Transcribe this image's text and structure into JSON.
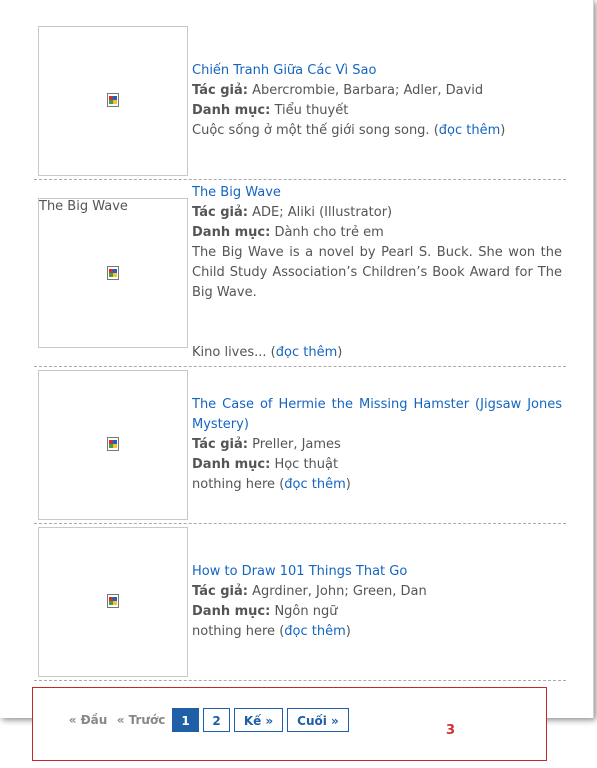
{
  "books": [
    {
      "title": "Chiến Tranh Giữa Các Vì Sao",
      "author_label": "Tác giả:",
      "authors": "Abercrombie, Barbara; Adler, David",
      "category_label": "Danh mục:",
      "category": "Tiểu thuyết",
      "description": "Cuộc sống ở một thế giới song song. (",
      "more": "đọc thêm",
      "close": ")"
    },
    {
      "title": "The Big Wave",
      "image_alt": "The Big Wave",
      "author_label": "Tác giả:",
      "authors": "ADE; Aliki (Illustrator)",
      "category_label": "Danh mục:",
      "category": "Dành cho trẻ em",
      "description": "The Big Wave is a novel by Pearl S. Buck. She won the Child Study Association’s Children’s Book Award for The Big Wave.",
      "tail": "Kino lives... (",
      "more": "đọc thêm",
      "close": ")"
    },
    {
      "title": "The Case of Hermie the Missing Hamster (Jigsaw Jones Mystery)",
      "author_label": "Tác giả:",
      "authors": "Preller, James",
      "category_label": "Danh mục:",
      "category": "Học thuật",
      "description": "nothing here (",
      "more": "đọc thêm",
      "close": ")"
    },
    {
      "title": "How to Draw 101 Things That Go",
      "author_label": "Tác giả:",
      "authors": "Agrdiner, John; Green, Dan",
      "category_label": "Danh mục:",
      "category": "Ngôn ngữ",
      "description": "nothing here (",
      "more": "đọc thêm",
      "close": ")"
    }
  ],
  "pagination": {
    "first": "« Đầu",
    "prev": "« Trước",
    "pages": [
      "1",
      "2"
    ],
    "current": "1",
    "next": "Kế »",
    "last": "Cuối »"
  },
  "annotation": "3",
  "colors": {
    "link": "#1565c0",
    "pager": "#1f5fa8",
    "annotation": "#d32f2f"
  },
  "icons": {
    "thumbnail": "broken-image-icon"
  }
}
